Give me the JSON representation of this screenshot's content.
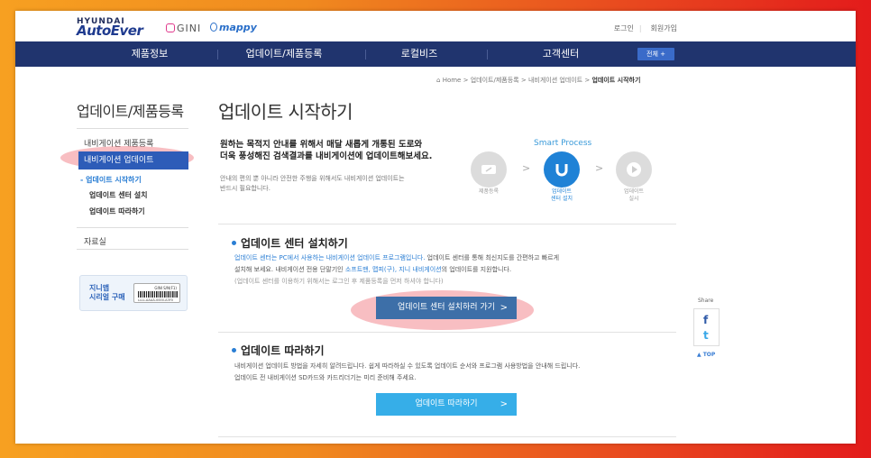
{
  "brand": {
    "top": "HYUNDAI",
    "name": "AutoEver",
    "gini": "GINI",
    "mappy": "mappy"
  },
  "toplinks": {
    "login": "로그인",
    "join": "회원가입"
  },
  "nav": {
    "items": [
      "제품정보",
      "업데이트/제품등록",
      "로컬비즈",
      "고객센터"
    ],
    "all": "전체 +"
  },
  "breadcrumb": {
    "home": "Home",
    "l1": "업데이트/제품등록",
    "l2": "내비게이션 업데이트",
    "current": "업데이트 시작하기",
    "sep": ">"
  },
  "sidebar": {
    "title": "업데이트/제품등록",
    "items": [
      "내비게이션 제품등록",
      "내비게이션 업데이트"
    ],
    "subitems": [
      "업데이트 시작하기",
      "업데이트 센터 설치",
      "업데이트 따라하기"
    ],
    "archive": "자료실",
    "card": {
      "line1": "지니맵",
      "line2": "시리얼 구매",
      "serial_label": "GINI S/N(F1)",
      "serial_num": "LLLL-AAAA-0000-A3F0"
    }
  },
  "main": {
    "title": "업데이트 시작하기",
    "intro_line1": "원하는 목적지 안내를 위해서 매달 새롭게 개통된 도로와",
    "intro_line2": "더욱 풍성해진 검색결과를 내비게이션에 업데이트해보세요.",
    "intro_sub1": "안내의 편의 뿐 아니라 안전한 주행을 위해서도 내비게이션 업데이트는",
    "intro_sub2": "반드시 필요합니다.",
    "smart_title": "Smart Process",
    "steps": [
      {
        "l1": "제품등록",
        "l2": ""
      },
      {
        "l1": "업데이트",
        "l2": "센터 설치"
      },
      {
        "l1": "업데이트",
        "l2": "실시"
      }
    ]
  },
  "section1": {
    "title": "업데이트 센터 설치하기",
    "d1_blue": "업데이트 센터는 PC에서 사용하는 내비게이션 업데이트 프로그램입니다.",
    "d1_rest": " 업데이트 센터를 통해 최신지도를 간편하고 빠르게",
    "d2_a": "설치해 보세요. 내비게이션 전용 단말기인 ",
    "d2_blue": "소프트맨, 맵피(구), 지니 내비게이션",
    "d2_b": "의 업데이트를 지원합니다.",
    "d3": "(업데이트 센터를 이용하기 위해서는 로그인 후 제품등록을 먼저 하셔야 합니다)",
    "button": "업데이트 센터 설치하러 가기"
  },
  "section2": {
    "title": "업데이트 따라하기",
    "d1": "내비게이션 업데이트 방법을 자세히 알려드립니다. 쉽게 따라하실 수 있도록 업데이트 순서와 프로그램 사용방법을 안내해 드립니다.",
    "d2": "업데이트 전 내비게이션 SD카드와 카드리더기는 미리 준비해 주세요.",
    "button": "업데이트 따라하기"
  },
  "share": {
    "label": "Share",
    "facebook": "f",
    "twitter": "t",
    "top": "▲ TOP"
  },
  "colors": {
    "nav": "#20346e",
    "accent": "#2a7ed4",
    "button_dark": "#3d6fa8",
    "button_light": "#36aee8"
  }
}
